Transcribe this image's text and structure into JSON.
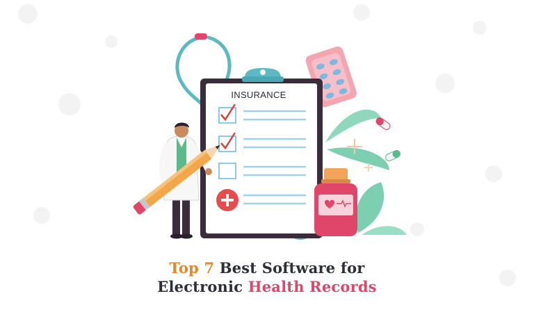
{
  "illustration": {
    "clipboard_label": "INSURANCE"
  },
  "headline": {
    "line1_accent": "Top 7",
    "line1_rest": " Best Software for",
    "line2_rest": "Electronic ",
    "line2_accent": "Health Records"
  },
  "colors": {
    "accent_orange": "#e8872a",
    "accent_pink": "#e0456a",
    "teal": "#5bb9c4",
    "clipboard_board": "#3a2c3a",
    "leaf_green": "#7ccfb0"
  }
}
